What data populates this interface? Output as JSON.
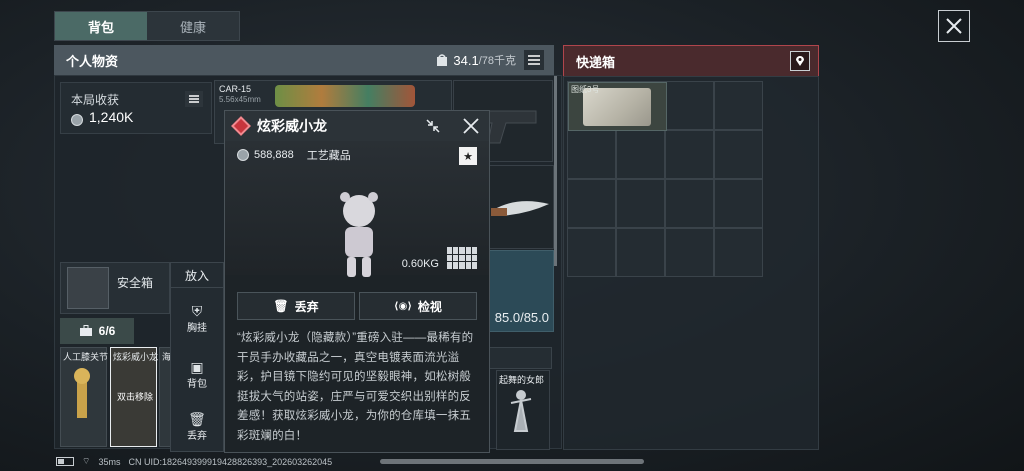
{
  "tabs": [
    {
      "label": "背包",
      "active": true
    },
    {
      "label": "健康",
      "active": false
    }
  ],
  "personal_panel": {
    "title": "个人物资",
    "weight_value": "34.1",
    "weight_capacity": "/78千克"
  },
  "earnings": {
    "label": "本局收获",
    "value": "1,240K"
  },
  "safe_box": {
    "label": "安全箱"
  },
  "slots_count": "6/6",
  "slots": [
    {
      "label": "人工膝关节"
    },
    {
      "label": "炫彩威小龙",
      "overlay": "双击移除"
    },
    {
      "label": "海"
    }
  ],
  "weapon": {
    "name": "CAR-15",
    "caliber": "5.56x45mm"
  },
  "armor_durability": "85.0/85.0",
  "statue_label": "起舞的女郎",
  "action_menu": {
    "header": "放入",
    "items": [
      {
        "label": "胸挂",
        "icon": "vest-icon"
      },
      {
        "label": "背包",
        "icon": "backpack-icon"
      },
      {
        "label": "丢弃",
        "icon": "trash-icon"
      }
    ]
  },
  "popup": {
    "title": "炫彩威小龙",
    "price": "588,888",
    "category": "工艺藏品",
    "weight": "0.60KG",
    "discard_label": "丢弃",
    "inspect_label": "检视",
    "description": "“炫彩威小龙（隐藏款）”重磅入驻——最稀有的干员手办收藏品之一，真空电镀表面流光溢彩，护目镜下隐约可见的坚毅眼神，如松树般挺拔大气的站姿，庄严与可爱交织出别样的反差感！获取炫彩威小龙，为你的仓库填一抹五彩斑斓的白！"
  },
  "quick_box": {
    "title": "快递箱",
    "item_label": "图纸3号"
  },
  "status_bar": {
    "ping": "35ms",
    "uid": "CN UID:18264939991942882639​3_202603262045"
  },
  "colors": {
    "accent_red": "#c8353d",
    "tab_active": "#4b6a66",
    "quick_border": "#b0454c"
  }
}
